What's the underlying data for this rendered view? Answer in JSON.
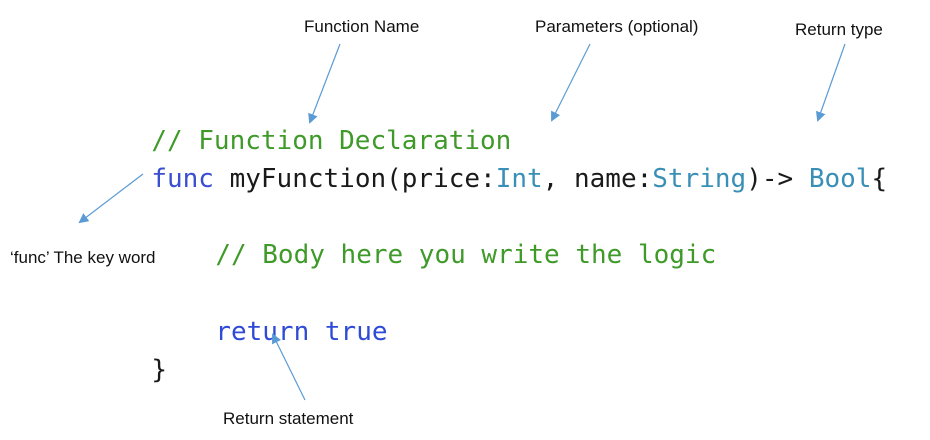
{
  "labels": {
    "function_name": "Function Name",
    "parameters": "Parameters (optional)",
    "return_type": "Return type",
    "func_keyword": "‘func’ The key word",
    "return_statement": "Return statement"
  },
  "code": {
    "line1_comment": "// Function Declaration",
    "line2": {
      "keyword": "func",
      "fn_name": " myFunction(",
      "param1_name": "price:",
      "param1_type": "Int",
      "sep": ", ",
      "param2_name": "name:",
      "param2_type": "String",
      "arrow": ")-> ",
      "return_type": "Bool",
      "brace_open": "{"
    },
    "line3_comment": "// Body here you write the logic",
    "line4": {
      "return_kw": "return",
      "space": " ",
      "value": "true"
    },
    "line5_brace": "}"
  },
  "colors": {
    "keyword": "#3a4fd0",
    "comment": "#3f9a2a",
    "type": "#3a8fb6",
    "arrow": "#5b9bd5"
  }
}
